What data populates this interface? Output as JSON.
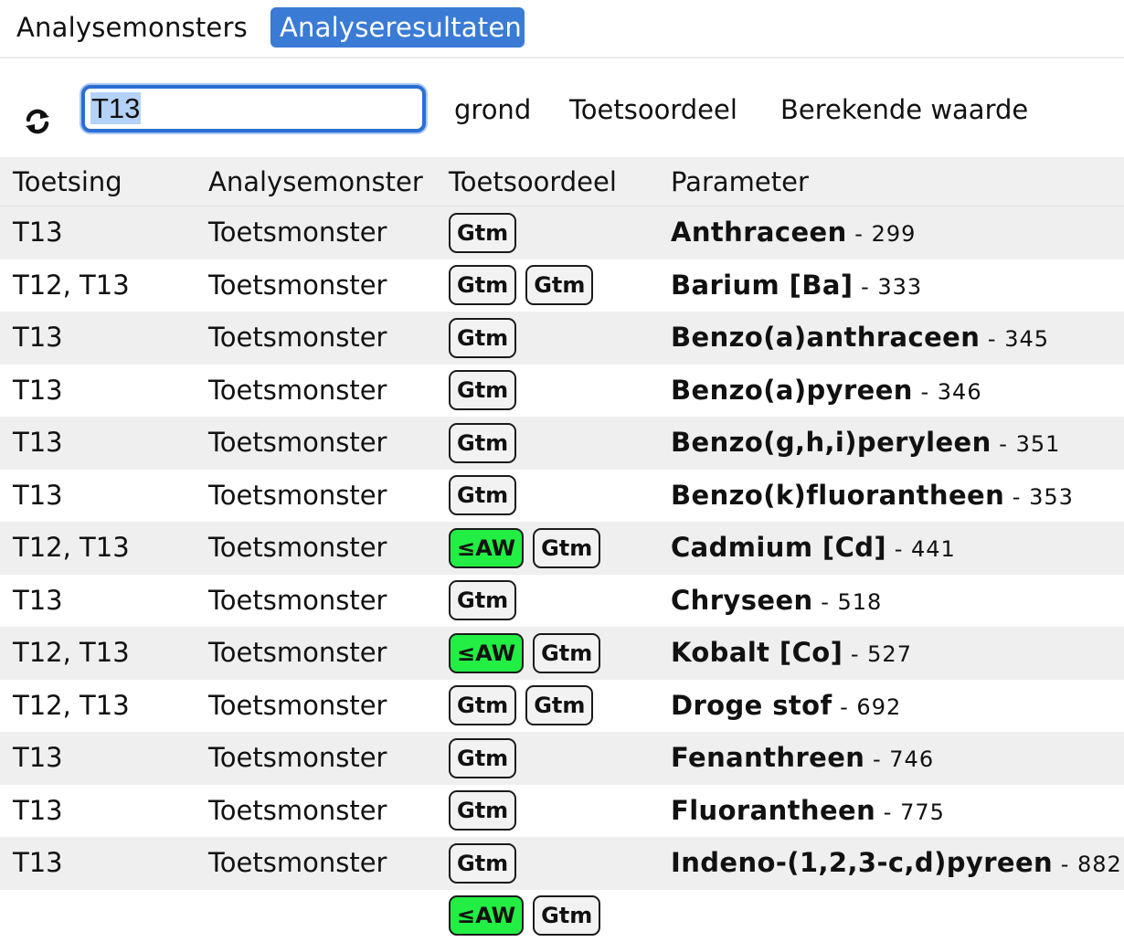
{
  "tabs": [
    {
      "label": "Analysemonsters",
      "active": false
    },
    {
      "label": "Analyseresultaten",
      "active": true
    }
  ],
  "toolbar": {
    "refresh_icon": "refresh-icon",
    "search_value": "T13",
    "filters": [
      "grond",
      "Toetsoordeel",
      "Berekende waarde"
    ]
  },
  "table": {
    "headers": [
      "Toetsing",
      "Analysemonster",
      "Toetsoordeel",
      "Parameter"
    ],
    "rows": [
      {
        "toetsing": "T13",
        "monster": "Toetsmonster",
        "oordeel": [
          "Gtm"
        ],
        "param": "Anthraceen",
        "id": "299"
      },
      {
        "toetsing": "T12, T13",
        "monster": "Toetsmonster",
        "oordeel": [
          "Gtm",
          "Gtm"
        ],
        "param": "Barium [Ba]",
        "id": "333"
      },
      {
        "toetsing": "T13",
        "monster": "Toetsmonster",
        "oordeel": [
          "Gtm"
        ],
        "param": "Benzo(a)anthraceen",
        "id": "345"
      },
      {
        "toetsing": "T13",
        "monster": "Toetsmonster",
        "oordeel": [
          "Gtm"
        ],
        "param": "Benzo(a)pyreen",
        "id": "346"
      },
      {
        "toetsing": "T13",
        "monster": "Toetsmonster",
        "oordeel": [
          "Gtm"
        ],
        "param": "Benzo(g,h,i)peryleen",
        "id": "351"
      },
      {
        "toetsing": "T13",
        "monster": "Toetsmonster",
        "oordeel": [
          "Gtm"
        ],
        "param": "Benzo(k)fluorantheen",
        "id": "353"
      },
      {
        "toetsing": "T12, T13",
        "monster": "Toetsmonster",
        "oordeel": [
          "≤AW",
          "Gtm"
        ],
        "param": "Cadmium [Cd]",
        "id": "441"
      },
      {
        "toetsing": "T13",
        "monster": "Toetsmonster",
        "oordeel": [
          "Gtm"
        ],
        "param": "Chryseen",
        "id": "518"
      },
      {
        "toetsing": "T12, T13",
        "monster": "Toetsmonster",
        "oordeel": [
          "≤AW",
          "Gtm"
        ],
        "param": "Kobalt [Co]",
        "id": "527"
      },
      {
        "toetsing": "T12, T13",
        "monster": "Toetsmonster",
        "oordeel": [
          "Gtm",
          "Gtm"
        ],
        "param": "Droge stof",
        "id": "692"
      },
      {
        "toetsing": "T13",
        "monster": "Toetsmonster",
        "oordeel": [
          "Gtm"
        ],
        "param": "Fenanthreen",
        "id": "746"
      },
      {
        "toetsing": "T13",
        "monster": "Toetsmonster",
        "oordeel": [
          "Gtm"
        ],
        "param": "Fluorantheen",
        "id": "775"
      },
      {
        "toetsing": "T13",
        "monster": "Toetsmonster",
        "oordeel": [
          "Gtm"
        ],
        "param": "Indeno-(1,2,3-c,d)pyreen",
        "id": "882"
      },
      {
        "toetsing": "",
        "monster": "",
        "oordeel": [
          "≤AW",
          "Gtm"
        ],
        "param": "",
        "id": ""
      }
    ]
  },
  "colors": {
    "accent": "#3a7bd5",
    "badge_green": "#22ee44",
    "badge_neutral": "#f2f2f2"
  }
}
